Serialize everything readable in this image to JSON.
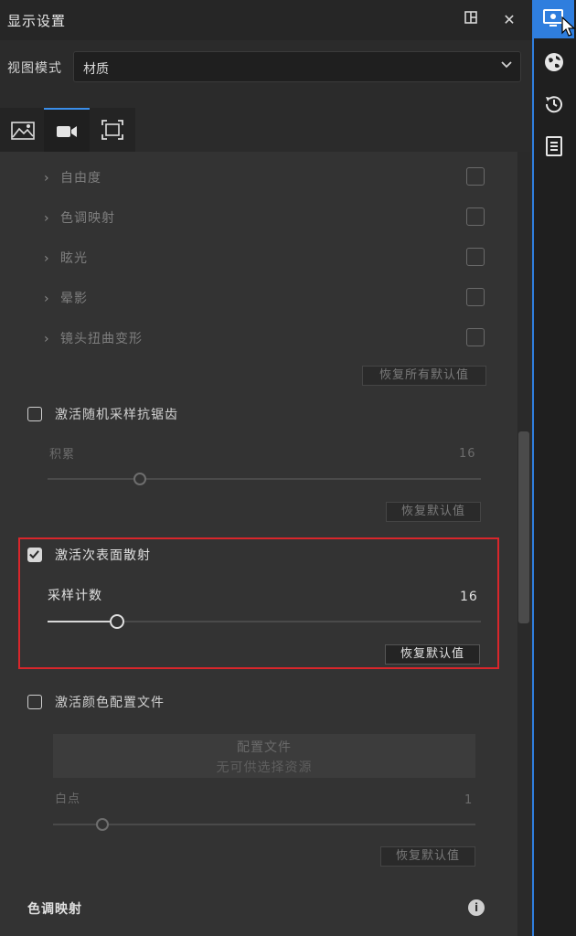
{
  "window": {
    "title": "显示设置"
  },
  "view_mode": {
    "label": "视图模式",
    "value": "材质"
  },
  "tabs": [
    {
      "icon": "environment-icon",
      "active": false
    },
    {
      "icon": "camera-icon",
      "active": true
    },
    {
      "icon": "frame-icon",
      "active": false
    }
  ],
  "camera_effects": {
    "items": [
      {
        "label": "自由度"
      },
      {
        "label": "色调映射"
      },
      {
        "label": "眩光"
      },
      {
        "label": "晕影"
      },
      {
        "label": "镜头扭曲变形"
      }
    ],
    "reset_all": "恢复所有默认值"
  },
  "antialias": {
    "label": "激活随机采样抗锯齿",
    "checked": false,
    "slider_label": "积累",
    "slider_value": "16",
    "reset": "恢复默认值"
  },
  "subsurface": {
    "label": "激活次表面散射",
    "checked": true,
    "slider_label": "采样计数",
    "slider_value": "16",
    "reset": "恢复默认值"
  },
  "color_profile": {
    "label": "激活颜色配置文件",
    "checked": false,
    "profile_title": "配置文件",
    "profile_sub": "无可供选择资源",
    "slider_label": "白点",
    "slider_value": "1",
    "reset": "恢复默认值"
  },
  "tone_mapping": {
    "label": "色调映射"
  },
  "colors": {
    "accent": "#2f7ede",
    "highlight_box": "#d9262b"
  }
}
